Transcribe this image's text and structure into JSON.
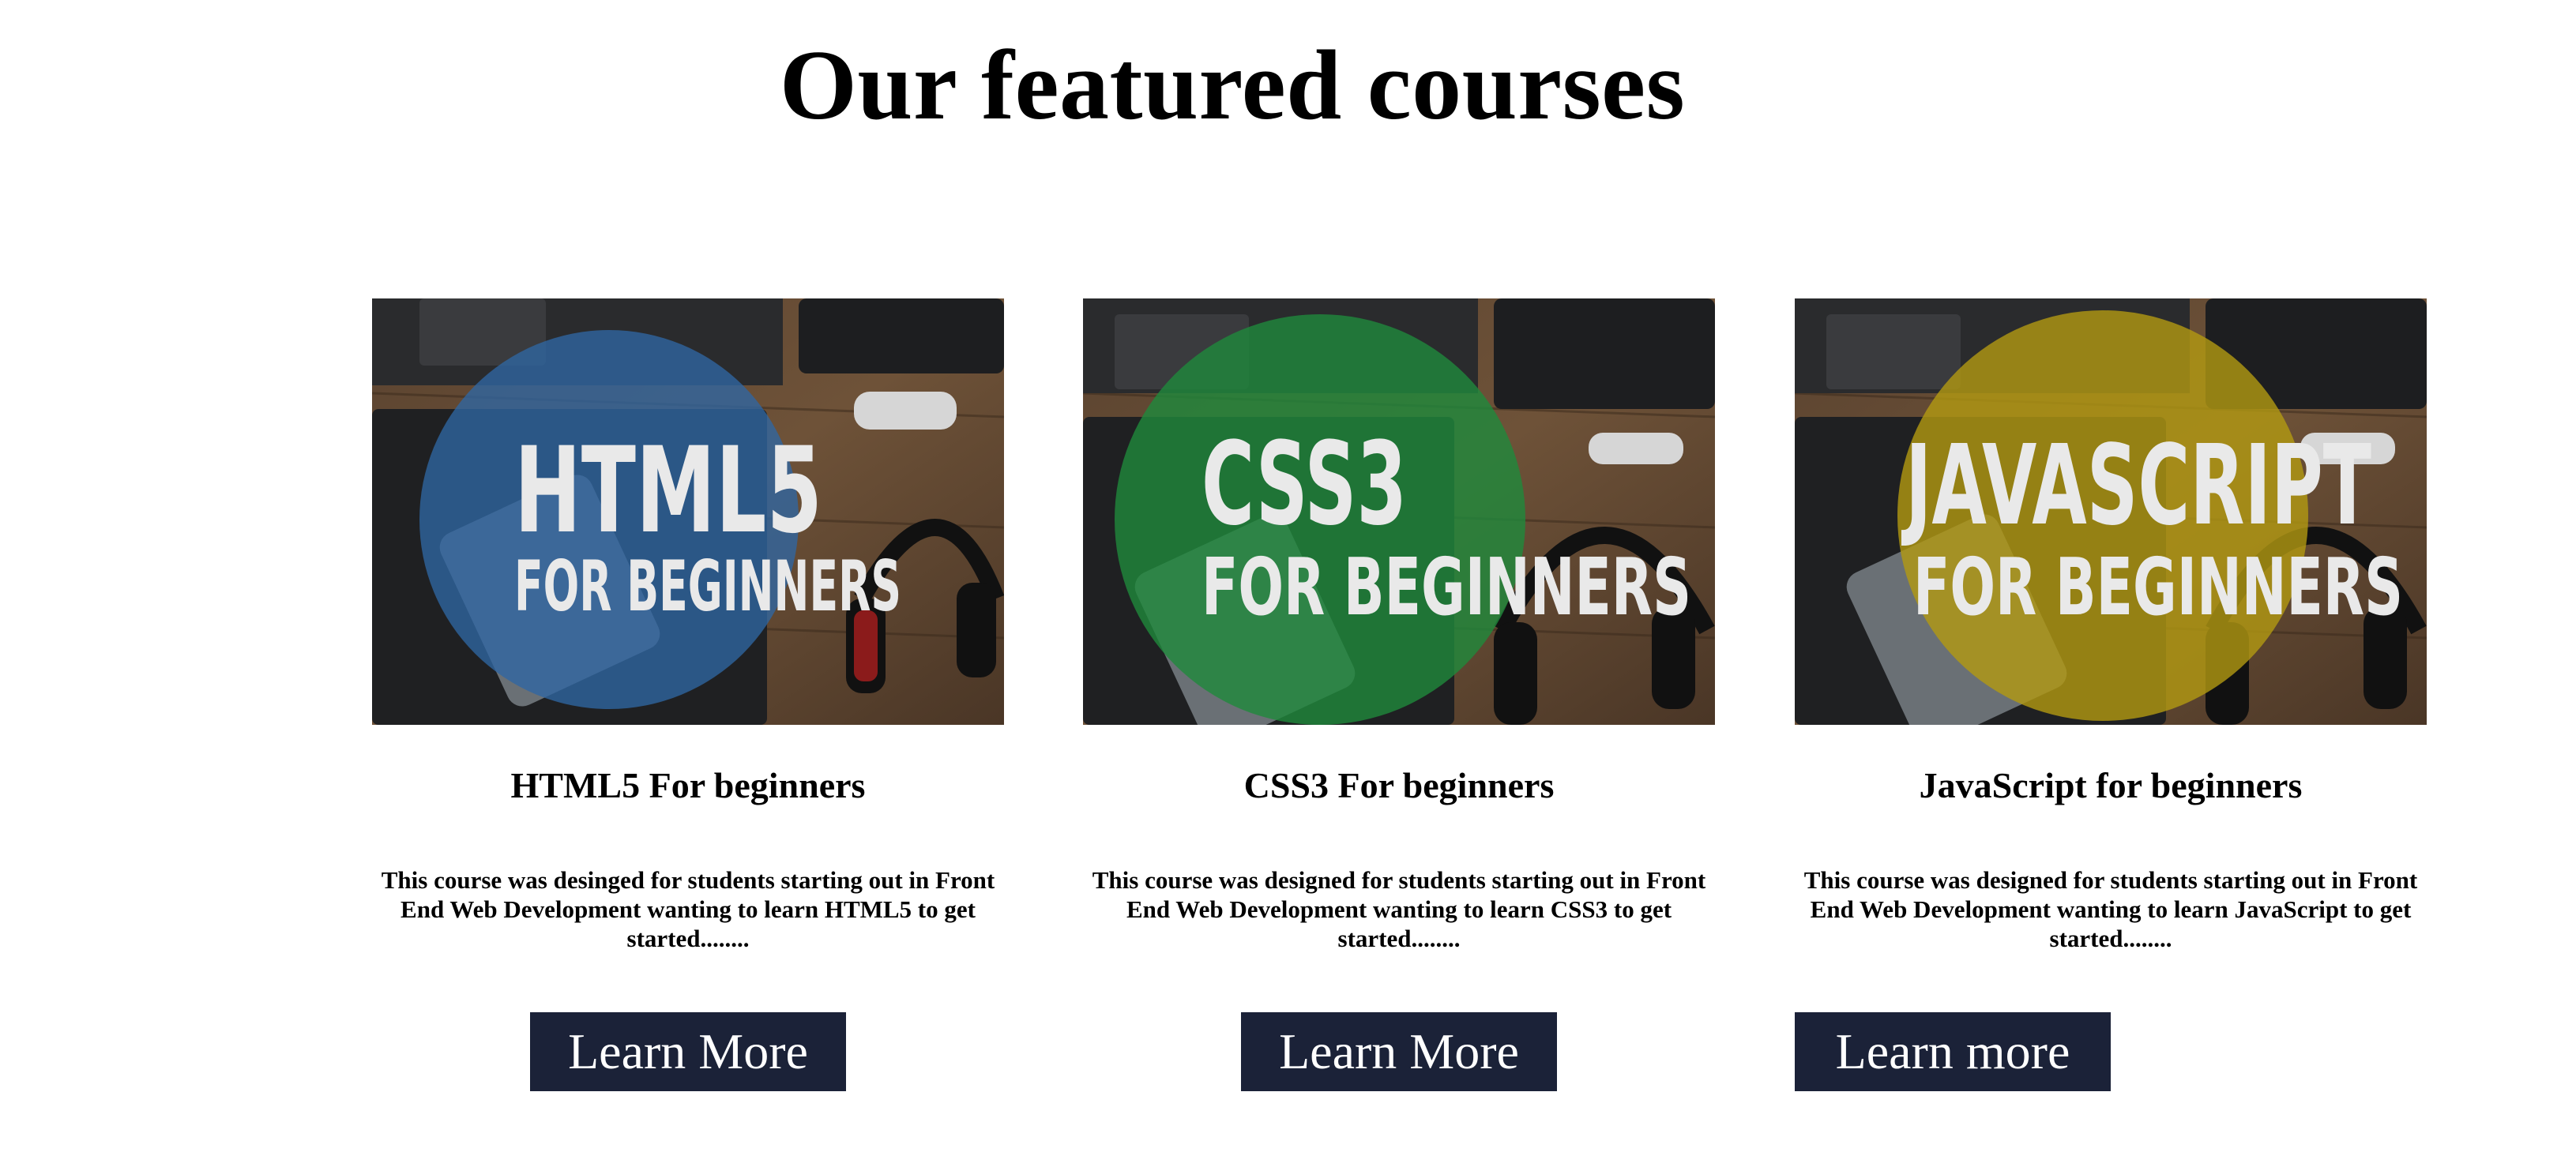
{
  "page": {
    "title": "Our featured courses"
  },
  "colors": {
    "button_bg": "#1b2238",
    "button_text": "#ffffff",
    "html_circle": "#2f66a3",
    "css_circle": "#1f8a3c",
    "js_circle": "#b39a12"
  },
  "courses": [
    {
      "image_line1": "HTML5",
      "image_line2": "FOR BEGINNERS",
      "title": "HTML5 For beginners",
      "description": "This course was desinged for students starting out in Front End Web Development wanting to learn HTML5 to get started........",
      "button_label": "Learn More"
    },
    {
      "image_line1": "CSS3",
      "image_line2": "FOR BEGINNERS",
      "title": "CSS3 For beginners",
      "description": "This course was designed for students starting out in Front End Web Development wanting to learn CSS3 to get started........",
      "button_label": "Learn More"
    },
    {
      "image_line1": "JAVASCRIPT",
      "image_line2": "FOR BEGINNERS",
      "title": "JavaScript for beginners",
      "description": "This course was designed for students starting out in Front End Web Development wanting to learn JavaScript to get started........",
      "button_label": "Learn more"
    }
  ]
}
